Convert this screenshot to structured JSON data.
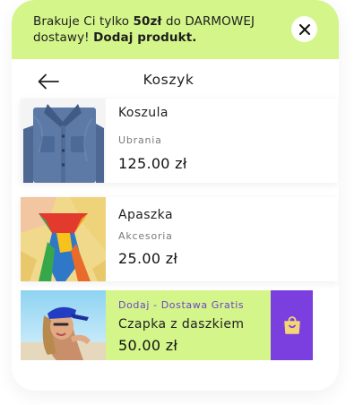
{
  "banner": {
    "text_1": "Brakuje Ci tylko ",
    "amount": "50zł",
    "text_2": " do DARMOWEJ dostawy! ",
    "cta": "Dodaj produkt."
  },
  "header": {
    "title": "Koszyk",
    "back_icon": "arrow-left-icon"
  },
  "items": [
    {
      "name": "Koszula",
      "category": "Ubrania",
      "price": "125.00 zł"
    },
    {
      "name": "Apaszka",
      "category": "Akcesoria",
      "price": "25.00 zł"
    }
  ],
  "suggestion": {
    "promo": "Dodaj - Dostawa Gratis",
    "name": "Czapka z daszkiem",
    "price": "50.00 zł",
    "add_icon": "shopping-bag-icon"
  },
  "colors": {
    "accent_green": "#d3f58a",
    "accent_purple": "#7b3fe0",
    "promo_text": "#6d45c7"
  }
}
